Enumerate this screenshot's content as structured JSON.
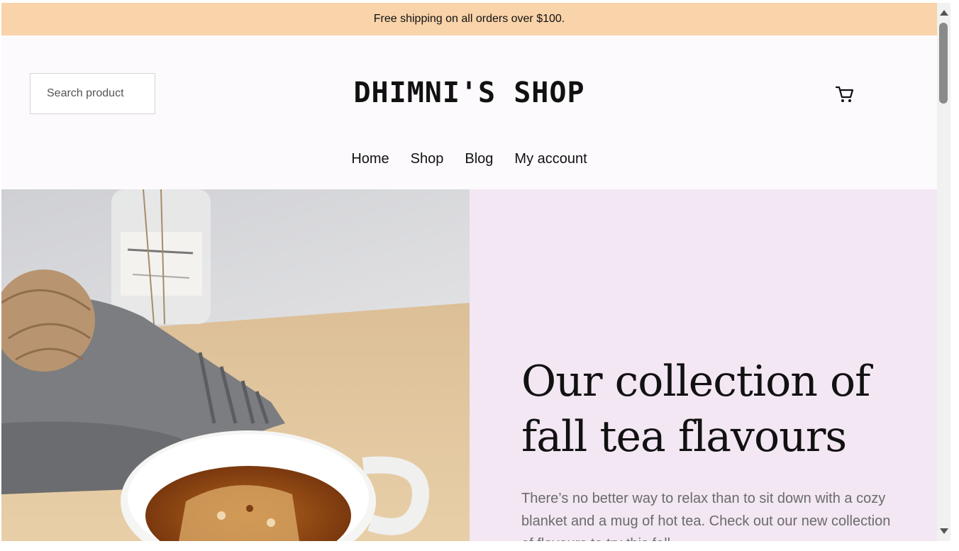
{
  "announcement": {
    "text": "Free shipping on all orders over $100."
  },
  "header": {
    "search_placeholder": "Search product",
    "site_title": "DHIMNI'S SHOP",
    "cart_icon": "cart-icon"
  },
  "nav": {
    "items": [
      {
        "label": "Home"
      },
      {
        "label": "Shop"
      },
      {
        "label": "Blog"
      },
      {
        "label": "My account"
      }
    ]
  },
  "hero": {
    "heading": "Our collection of fall tea flavours",
    "description": "There’s no better way to relax than to sit down with a cozy blanket and a mug of hot tea. Check out our new collection of flavours to try this fall.",
    "image_subject": "cup of tea with knitted blanket and yarn ball"
  },
  "colors": {
    "announcement_bg": "#f9d3a9",
    "hero_text_bg": "#f2e7f3",
    "page_bg": "#fdfafd"
  }
}
